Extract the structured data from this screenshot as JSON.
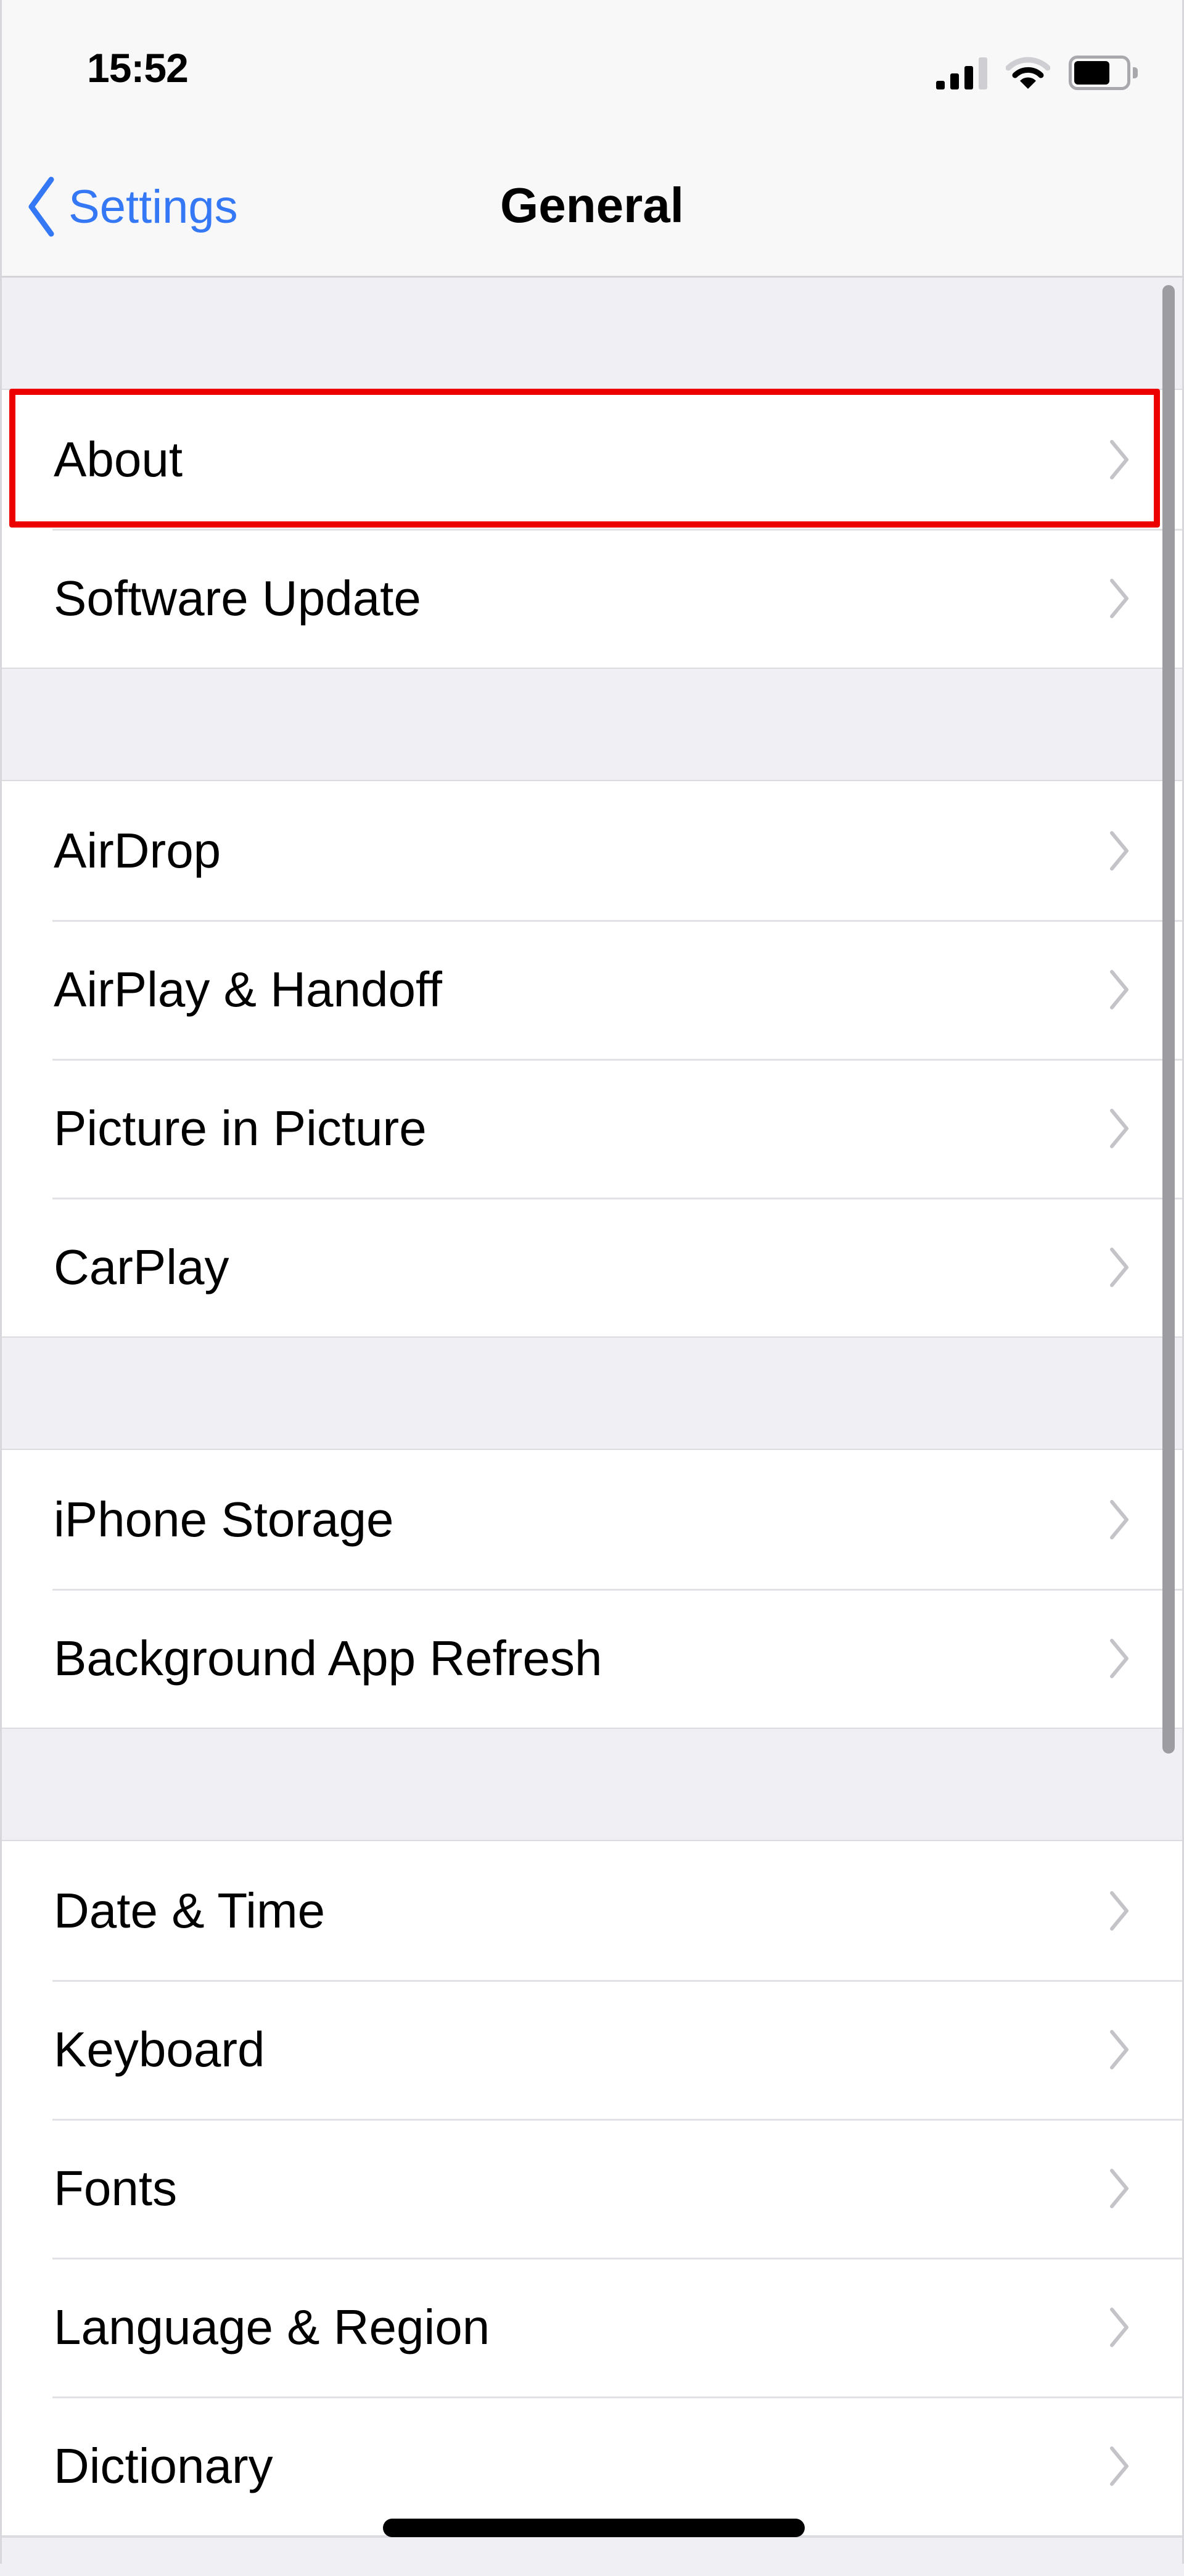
{
  "status_bar": {
    "time": "15:52",
    "signal_bars_active": 3,
    "signal_bars_total": 4,
    "wifi_arcs_active": 2,
    "wifi_arcs_total": 3,
    "battery_level": 0.7,
    "icons": [
      "cellular-signal-icon",
      "wifi-icon",
      "battery-icon"
    ]
  },
  "nav": {
    "back_label": "Settings",
    "back_icon": "chevron-left-icon",
    "title": "General"
  },
  "colors": {
    "accent": "#3478f6",
    "highlight": "#ec0000",
    "grouped_background": "#efeff4",
    "chevron": "#c4c4c8"
  },
  "groups": [
    {
      "items": [
        {
          "label": "About",
          "highlighted": true
        },
        {
          "label": "Software Update"
        }
      ]
    },
    {
      "items": [
        {
          "label": "AirDrop"
        },
        {
          "label": "AirPlay & Handoff"
        },
        {
          "label": "Picture in Picture"
        },
        {
          "label": "CarPlay"
        }
      ]
    },
    {
      "items": [
        {
          "label": "iPhone Storage"
        },
        {
          "label": "Background App Refresh"
        }
      ]
    },
    {
      "items": [
        {
          "label": "Date & Time"
        },
        {
          "label": "Keyboard"
        },
        {
          "label": "Fonts"
        },
        {
          "label": "Language & Region"
        },
        {
          "label": "Dictionary"
        }
      ]
    }
  ],
  "row_accessory_icon": "chevron-right-icon"
}
